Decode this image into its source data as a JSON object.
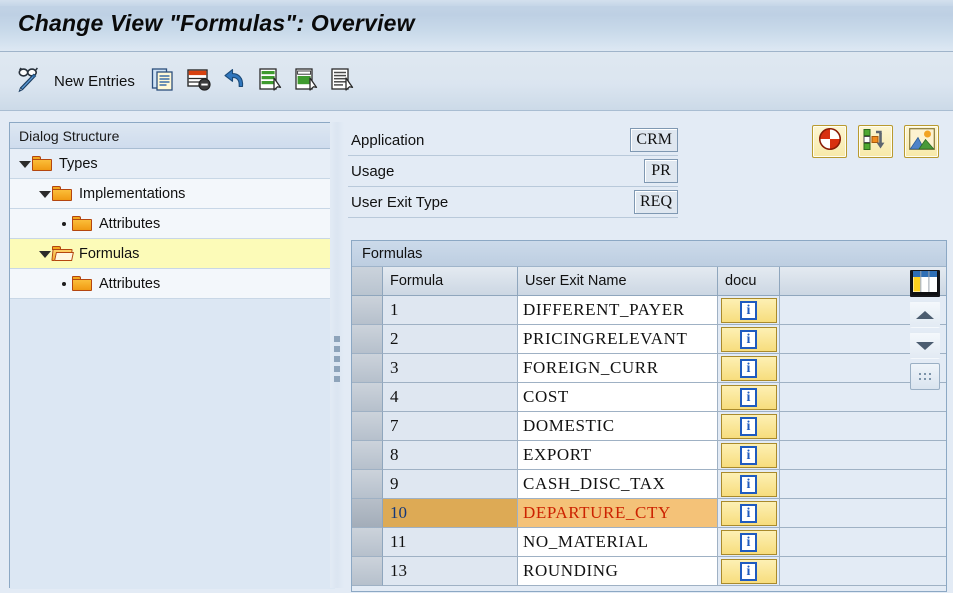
{
  "window": {
    "title": "Change View \"Formulas\": Overview"
  },
  "toolbar": {
    "display_change_icon": "glasses-pencil-icon",
    "new_entries_label": "New Entries",
    "buttons": [
      {
        "name": "copy-as-icon",
        "tooltip": "Copy As..."
      },
      {
        "name": "delete-row-icon",
        "tooltip": "Delete"
      },
      {
        "name": "undo-icon",
        "tooltip": "Undo Change"
      },
      {
        "name": "select-all-icon",
        "tooltip": "Select All"
      },
      {
        "name": "select-block-icon",
        "tooltip": "Select Block"
      },
      {
        "name": "deselect-all-icon",
        "tooltip": "Deselect All"
      }
    ]
  },
  "dialog_structure": {
    "header": "Dialog Structure",
    "items": [
      {
        "label": "Types",
        "indent": 0,
        "expander": "down",
        "folder": "closed",
        "selected": false
      },
      {
        "label": "Implementations",
        "indent": 1,
        "expander": "down",
        "folder": "closed",
        "selected": false
      },
      {
        "label": "Attributes",
        "indent": 2,
        "expander": "bullet",
        "folder": "closed",
        "selected": false
      },
      {
        "label": "Formulas",
        "indent": 1,
        "expander": "down",
        "folder": "open",
        "selected": true
      },
      {
        "label": "Attributes",
        "indent": 2,
        "expander": "bullet",
        "folder": "closed",
        "selected": false
      }
    ]
  },
  "form": {
    "rows": [
      {
        "label": "Application",
        "value": "CRM"
      },
      {
        "label": "Usage",
        "value": "PR"
      },
      {
        "label": "User Exit Type",
        "value": "REQ"
      }
    ]
  },
  "top_buttons": [
    {
      "name": "variant-pinwheel-icon",
      "tooltip": "Position"
    },
    {
      "name": "structure-arrow-icon",
      "tooltip": "Navigate"
    },
    {
      "name": "landscape-image-icon",
      "tooltip": "Graphic"
    }
  ],
  "table": {
    "title": "Formulas",
    "columns": [
      "Formula",
      "User Exit Name",
      "docu"
    ],
    "doc_button_icon": "info-icon",
    "rows": [
      {
        "formula": "1",
        "user_exit_name": "DIFFERENT_PAYER",
        "docu": "i",
        "highlighted": false
      },
      {
        "formula": "2",
        "user_exit_name": "PRICINGRELEVANT",
        "docu": "i",
        "highlighted": false
      },
      {
        "formula": "3",
        "user_exit_name": "FOREIGN_CURR",
        "docu": "i",
        "highlighted": false
      },
      {
        "formula": "4",
        "user_exit_name": "COST",
        "docu": "i",
        "highlighted": false
      },
      {
        "formula": "7",
        "user_exit_name": "DOMESTIC",
        "docu": "i",
        "highlighted": false
      },
      {
        "formula": "8",
        "user_exit_name": "EXPORT",
        "docu": "i",
        "highlighted": false
      },
      {
        "formula": "9",
        "user_exit_name": "CASH_DISC_TAX",
        "docu": "i",
        "highlighted": false
      },
      {
        "formula": "10",
        "user_exit_name": "DEPARTURE_CTY",
        "docu": "i",
        "highlighted": true
      },
      {
        "formula": "11",
        "user_exit_name": "NO_MATERIAL",
        "docu": "i",
        "highlighted": false
      },
      {
        "formula": "13",
        "user_exit_name": "ROUNDING",
        "docu": "i",
        "highlighted": false
      }
    ],
    "tools": [
      {
        "name": "column-config-icon",
        "tooltip": "Configure Columns"
      },
      {
        "name": "scroll-up-icon",
        "tooltip": "Scroll Up"
      },
      {
        "name": "scroll-down-icon",
        "tooltip": "Scroll Down"
      },
      {
        "name": "resize-grip-icon",
        "tooltip": "Resize"
      }
    ]
  },
  "colors": {
    "title_bar": "#c3d4e6",
    "selection_yellow": "#fcfbb8",
    "row_highlight": "#ddaa55",
    "row_highlight_text": "#cc2200",
    "accent_folder": "#f2a71c",
    "button_yellow": "#f7e9a8"
  }
}
